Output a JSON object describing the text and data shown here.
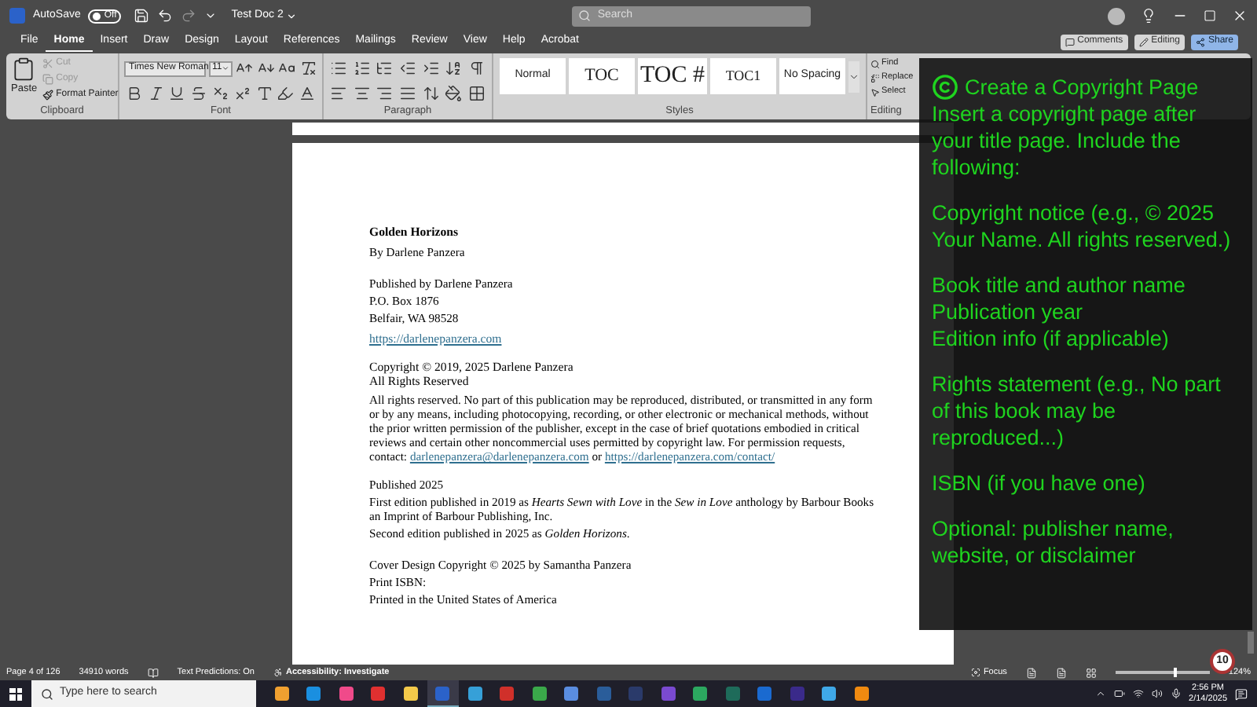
{
  "title_bar": {
    "autosave_label": "AutoSave",
    "autosave_on": false,
    "toggle_label": "Off",
    "document_title": "Test Doc 2",
    "search_placeholder": "Search"
  },
  "menu_tabs": [
    {
      "label": "File",
      "selected": false
    },
    {
      "label": "Home",
      "selected": true
    },
    {
      "label": "Insert",
      "selected": false
    },
    {
      "label": "Draw",
      "selected": false
    },
    {
      "label": "Design",
      "selected": false
    },
    {
      "label": "Layout",
      "selected": false
    },
    {
      "label": "References",
      "selected": false
    },
    {
      "label": "Mailings",
      "selected": false
    },
    {
      "label": "Review",
      "selected": false
    },
    {
      "label": "View",
      "selected": false
    },
    {
      "label": "Help",
      "selected": false
    },
    {
      "label": "Acrobat",
      "selected": false
    }
  ],
  "header_buttons": [
    {
      "label": "Comments",
      "kind": "comments"
    },
    {
      "label": "Editing",
      "kind": "editing"
    },
    {
      "label": "Share",
      "kind": "share"
    }
  ],
  "ribbon": {
    "clipboard": {
      "paste": "Paste",
      "items": [
        {
          "label": "Cut",
          "disabled": true
        },
        {
          "label": "Copy",
          "disabled": true
        },
        {
          "label": "Format Painter",
          "disabled": false
        }
      ],
      "label": "Clipboard"
    },
    "font": {
      "font_name": "Times New Roman",
      "font_size": "11",
      "label": "Font"
    },
    "paragraph": {
      "label": "Paragraph"
    },
    "styles": {
      "items": [
        {
          "label": "Normal",
          "kind": "small"
        },
        {
          "label": "TOC",
          "kind": "medium"
        },
        {
          "label": "TOC #",
          "kind": "large"
        },
        {
          "label": "TOC1",
          "kind": "medium-small"
        },
        {
          "label": "No Spacing",
          "kind": "small"
        }
      ],
      "label": "Styles"
    },
    "editing": {
      "items": [
        "Find",
        "Replace",
        "Select"
      ],
      "label": "Editing"
    }
  },
  "document": {
    "sections": [
      [
        {
          "kind": "bold",
          "text": "Golden Horizons"
        },
        {
          "kind": "text",
          "text": "By Darlene Panzera"
        }
      ],
      [
        {
          "kind": "text",
          "text": "Published by Darlene Panzera"
        },
        {
          "kind": "text",
          "text": "P.O. Box 1876"
        },
        {
          "kind": "text",
          "text": "Belfair, WA 98528"
        },
        {
          "kind": "link",
          "text": "https://darlenepanzera.com"
        }
      ],
      [
        {
          "kind": "tight",
          "text": "Copyright © 2019, 2025 Darlene Panzera"
        },
        {
          "kind": "tight",
          "text": "All Rights Reserved"
        },
        {
          "kind": "mixed",
          "parts": [
            {
              "kind": "text",
              "text": "All rights reserved. No part of this publication may be reproduced, distributed, or transmitted in any form or by any means, including photocopying, recording, or other electronic or mechanical methods, without the prior written permission of the publisher, except in the case of brief quotations embodied in critical reviews and certain other noncommercial uses permitted by copyright law. For permission requests, contact: "
            },
            {
              "kind": "link",
              "text": "darlenepanzera@darlenepanzera.com"
            },
            {
              "kind": "text",
              "text": " or "
            },
            {
              "kind": "link",
              "text": "https://darlenepanzera.com/contact/"
            }
          ]
        }
      ],
      [
        {
          "kind": "text",
          "text": "Published 2025"
        },
        {
          "kind": "text",
          "text": "First edition published in 2019 as *Hearts Sewn with Love* in the *Sew in Love* anthology by Barbour Books an Imprint of Barbour Publishing, Inc."
        },
        {
          "kind": "text",
          "text": "Second edition published in 2025 as *Golden Horizons*."
        }
      ],
      [
        {
          "kind": "text",
          "text": "Cover Design Copyright © 2025 by Samantha Panzera"
        },
        {
          "kind": "text",
          "text": "Print ISBN:"
        },
        {
          "kind": "text",
          "text": "Printed in the United States of America"
        }
      ]
    ]
  },
  "overlay": {
    "title": "Create a Copyright Page",
    "groups": [
      [
        "Insert a copyright page after your title page. Include the following:"
      ],
      [
        "Copyright notice (e.g., © 2025 Your Name. All rights reserved.)"
      ],
      [
        "Book title and author name",
        "Publication year",
        "Edition info (if applicable)"
      ],
      [
        "Rights statement (e.g., No part of this book may be reproduced...)"
      ],
      [
        "ISBN (if you have one)"
      ],
      [
        "Optional: publisher name, website, or disclaimer"
      ]
    ]
  },
  "status_bar": {
    "page": "Page 4 of 126",
    "words": "34910 words",
    "predictions": "Text Predictions: On",
    "accessibility": "Accessibility: Investigate",
    "focus": "Focus",
    "zoom": "124%",
    "zoom_level": {
      "level": 0.62
    },
    "badge": "10"
  },
  "taskbar": {
    "search_placeholder": "Type here to search",
    "apps": [
      {
        "color": "#f0a030",
        "selected": false
      },
      {
        "color": "#1a8fe0",
        "selected": false
      },
      {
        "color": "#f04a8a",
        "selected": false
      },
      {
        "color": "#e03030",
        "selected": false
      },
      {
        "color": "#f3c94a",
        "selected": false
      },
      {
        "color": "#2b62c9",
        "selected": true
      },
      {
        "color": "#36a0d8",
        "selected": false
      },
      {
        "color": "#d0302a",
        "selected": false
      },
      {
        "color": "#3aa84a",
        "selected": false
      },
      {
        "color": "#5a8de0",
        "selected": false
      },
      {
        "color": "#2a5d9a",
        "selected": false
      },
      {
        "color": "#2a3a6a",
        "selected": false
      },
      {
        "color": "#7a4ad0",
        "selected": false
      },
      {
        "color": "#2ca860",
        "selected": false
      },
      {
        "color": "#1e6b5a",
        "selected": false
      },
      {
        "color": "#1a6ad0",
        "selected": false
      },
      {
        "color": "#3a2a8a",
        "selected": false
      },
      {
        "color": "#3fa8e8",
        "selected": false
      },
      {
        "color": "#f08a10",
        "selected": false
      }
    ],
    "time": "2:56 PM",
    "date": "2/14/2025"
  }
}
